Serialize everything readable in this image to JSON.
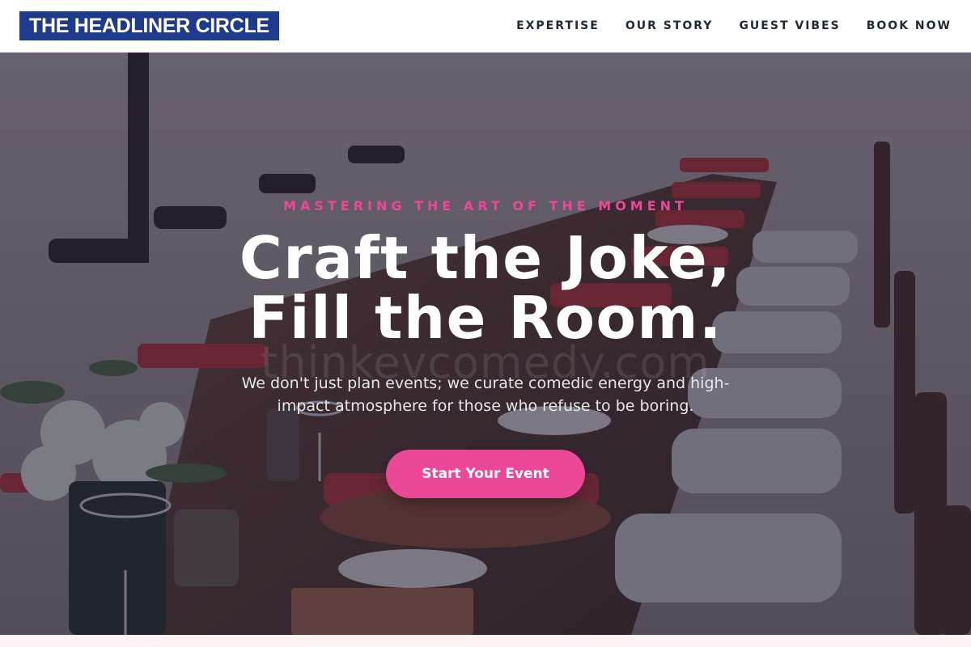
{
  "brand": {
    "logo_text": "THE HEADLINER CIRCLE",
    "logo_bg": "#1e3a8a"
  },
  "nav": {
    "items": [
      {
        "label": "EXPERTISE"
      },
      {
        "label": "OUR STORY"
      },
      {
        "label": "GUEST VIBES"
      },
      {
        "label": "BOOK NOW"
      }
    ]
  },
  "hero": {
    "background_image": "outdoor long dining table with wooden chairs, red napkins and woven placemats",
    "watermark_text": "thinkevcomedy.com",
    "eyebrow": "MASTERING THE ART OF THE MOMENT",
    "headline_line1": "Craft the Joke,",
    "headline_line2": "Fill the Room.",
    "subtext": "We don't just plan events; we curate comedic energy and high-impact atmosphere for those who refuse to be boring.",
    "cta_label": "Start Your Event"
  },
  "colors": {
    "accent": "#ec4899",
    "brand": "#1e3a8a"
  }
}
